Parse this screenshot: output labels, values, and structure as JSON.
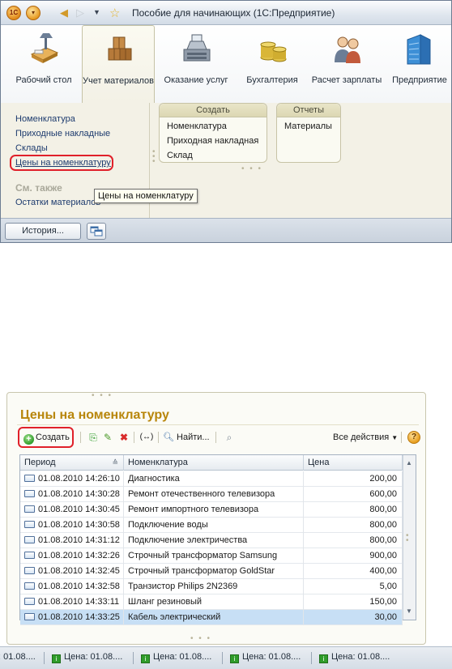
{
  "window1": {
    "title": "Пособие для начинающих  (1С:Предприятие)",
    "sections": [
      {
        "label": "Рабочий стол",
        "icon": "desk-icon"
      },
      {
        "label": "Учет материалов",
        "icon": "boxes-icon"
      },
      {
        "label": "Оказание услуг",
        "icon": "cash-register-icon"
      },
      {
        "label": "Бухгалтерия",
        "icon": "coins-icon"
      },
      {
        "label": "Расчет зарплаты",
        "icon": "people-icon"
      },
      {
        "label": "Предприятие",
        "icon": "building-icon"
      }
    ],
    "nav_links": [
      "Номенклатура",
      "Приходные накладные",
      "Склады",
      "Цены на номенклатуру"
    ],
    "see_also_label": "См. также",
    "see_also_links": [
      "Остатки материалов"
    ],
    "create_group": {
      "title": "Создать",
      "items": [
        "Номенклатура",
        "Приходная накладная",
        "Склад"
      ]
    },
    "reports_group": {
      "title": "Отчеты",
      "items": [
        "Материалы"
      ]
    },
    "tooltip": "Цены на номенклатуру",
    "history_button": "История..."
  },
  "window2": {
    "title": "Цены на номенклатуру",
    "toolbar": {
      "create_label": "Создать",
      "find_label": "Найти...",
      "all_actions_label": "Все действия"
    },
    "columns": [
      "Период",
      "Номенклатура",
      "Цена"
    ],
    "rows": [
      {
        "period": "01.08.2010 14:26:10",
        "item": "Диагностика",
        "price": "200,00"
      },
      {
        "period": "01.08.2010 14:30:28",
        "item": "Ремонт отечественного телевизора",
        "price": "600,00"
      },
      {
        "period": "01.08.2010 14:30:45",
        "item": "Ремонт импортного телевизора",
        "price": "800,00"
      },
      {
        "period": "01.08.2010 14:30:58",
        "item": "Подключение воды",
        "price": "800,00"
      },
      {
        "period": "01.08.2010 14:31:12",
        "item": "Подключение электричества",
        "price": "800,00"
      },
      {
        "period": "01.08.2010 14:32:26",
        "item": "Строчный трансформатор Samsung",
        "price": "900,00"
      },
      {
        "period": "01.08.2010 14:32:45",
        "item": "Строчный трансформатор GoldStar",
        "price": "400,00"
      },
      {
        "period": "01.08.2010 14:32:58",
        "item": "Транзистор Philips 2N2369",
        "price": "5,00"
      },
      {
        "period": "01.08.2010 14:33:11",
        "item": "Шланг резиновый",
        "price": "150,00"
      },
      {
        "period": "01.08.2010 14:33:25",
        "item": "Кабель электрический",
        "price": "30,00"
      }
    ],
    "selected_row": 9
  },
  "taskbar": {
    "items": [
      ": 01.08....",
      "Цена: 01.08....",
      "Цена: 01.08....",
      "Цена: 01.08....",
      "Цена: 01.08...."
    ]
  }
}
